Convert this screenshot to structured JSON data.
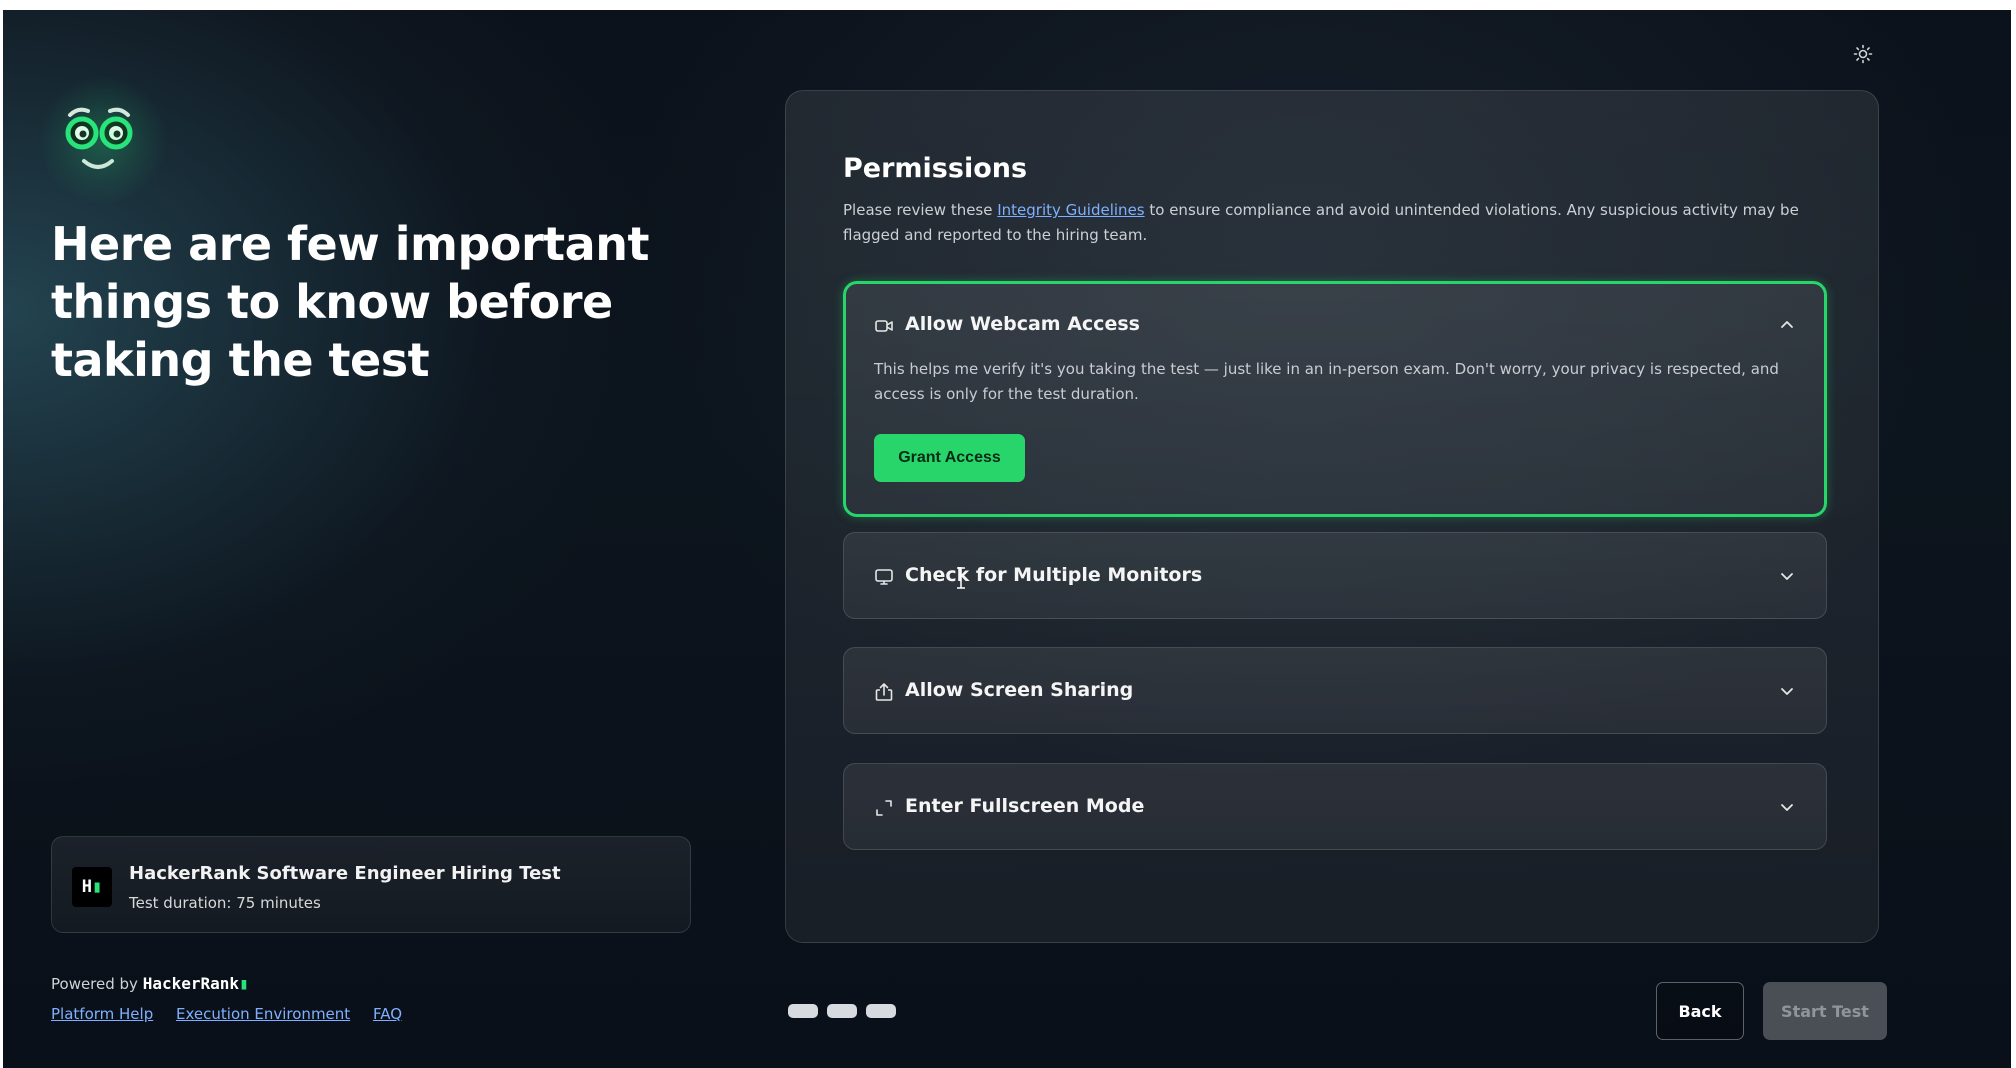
{
  "left": {
    "headline": "Here are few important things to know before taking the test",
    "test_card": {
      "title": "HackerRank Software Engineer Hiring Test",
      "duration": "Test duration: 75 minutes"
    },
    "powered_by": "Powered by",
    "brand": "HackerRank",
    "links": [
      "Platform Help",
      "Execution Environment",
      "FAQ"
    ]
  },
  "panel": {
    "title": "Permissions",
    "desc_before": "Please review these ",
    "desc_link": "Integrity Guidelines",
    "desc_after": " to ensure compliance and avoid unintended violations. Any suspicious activity may be flagged and reported to the hiring team.",
    "items": [
      {
        "icon": "webcam-icon",
        "title": "Allow Webcam Access",
        "expanded": true,
        "body": "This helps me verify it's you taking the test — just like in an in-person exam. Don't worry, your privacy is respected, and access is only for the test duration.",
        "button": "Grant Access"
      },
      {
        "icon": "monitor-icon",
        "title": "Check for Multiple Monitors",
        "expanded": false
      },
      {
        "icon": "share-screen-icon",
        "title": "Allow Screen Sharing",
        "expanded": false
      },
      {
        "icon": "fullscreen-icon",
        "title": "Enter Fullscreen Mode",
        "expanded": false
      }
    ]
  },
  "footer": {
    "back": "Back",
    "start": "Start Test",
    "step_dots": 3
  },
  "colors": {
    "accent": "#27d56b",
    "link": "#7fb0ff",
    "background": "#0c121b"
  }
}
